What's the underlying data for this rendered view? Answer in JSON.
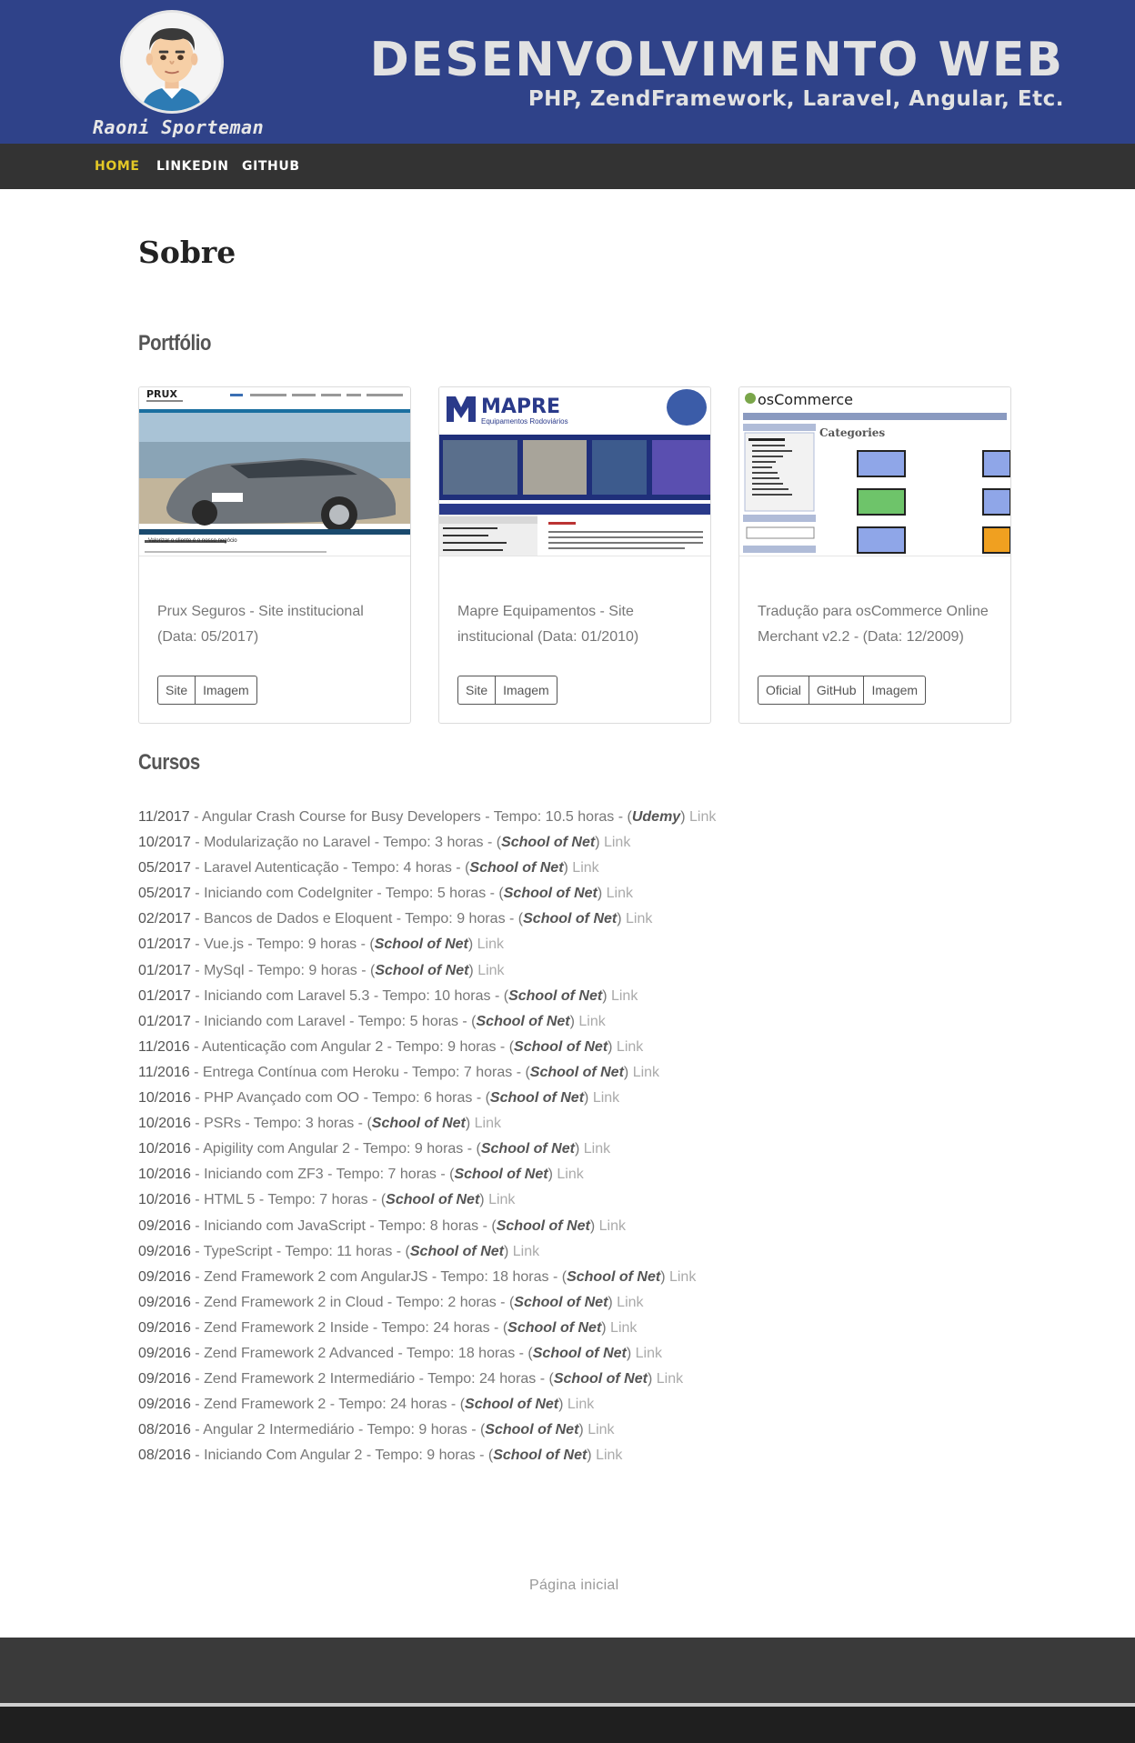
{
  "header": {
    "author": "Raoni Sporteman",
    "title": "DESENVOLVIMENTO WEB",
    "subtitle": "PHP, ZendFramework, Laravel, Angular, Etc."
  },
  "nav": {
    "items": [
      {
        "label": "HOME",
        "active": true
      },
      {
        "label": "LINKEDIN",
        "active": false
      },
      {
        "label": "GITHUB",
        "active": false
      }
    ]
  },
  "page": {
    "title": "Sobre",
    "portfolio_heading": "Portfólio",
    "courses_heading": "Cursos",
    "home_link": "Página inicial"
  },
  "portfolio": [
    {
      "thumb_brand": "PRUX",
      "thumb_tagline": "Valorizar o cliente é o nosso negócio",
      "description": "Prux Seguros - Site institucional (Data: 05/2017)",
      "buttons": [
        "Site",
        "Imagem"
      ]
    },
    {
      "thumb_brand": "MAPRE",
      "thumb_tagline": "Equipamentos Rodoviários",
      "description": "Mapre Equipamentos - Site institucional (Data: 01/2010)",
      "buttons": [
        "Site",
        "Imagem"
      ]
    },
    {
      "thumb_brand": "osCommerce",
      "thumb_tagline": "Categories",
      "description": "Tradução para osCommerce Online Merchant v2.2 - (Data: 12/2009)",
      "buttons": [
        "Oficial",
        "GitHub",
        "Imagem"
      ]
    }
  ],
  "courses": [
    {
      "date": "11/2017",
      "title": "Angular Crash Course for Busy Developers",
      "hours": "10.5",
      "school": "Udemy"
    },
    {
      "date": "10/2017",
      "title": "Modularização no Laravel",
      "hours": "3",
      "school": "School of Net"
    },
    {
      "date": "05/2017",
      "title": "Laravel Autenticação",
      "hours": "4",
      "school": "School of Net"
    },
    {
      "date": "05/2017",
      "title": "Iniciando com CodeIgniter",
      "hours": "5",
      "school": "School of Net"
    },
    {
      "date": "02/2017",
      "title": "Bancos de Dados e Eloquent",
      "hours": "9",
      "school": "School of Net"
    },
    {
      "date": "01/2017",
      "title": "Vue.js",
      "hours": "9",
      "school": "School of Net"
    },
    {
      "date": "01/2017",
      "title": "MySql",
      "hours": "9",
      "school": "School of Net"
    },
    {
      "date": "01/2017",
      "title": "Iniciando com Laravel 5.3",
      "hours": "10",
      "school": "School of Net"
    },
    {
      "date": "01/2017",
      "title": "Iniciando com Laravel",
      "hours": "5",
      "school": "School of Net"
    },
    {
      "date": "11/2016",
      "title": "Autenticação com Angular 2",
      "hours": "9",
      "school": "School of Net"
    },
    {
      "date": "11/2016",
      "title": "Entrega Contínua com Heroku",
      "hours": "7",
      "school": "School of Net"
    },
    {
      "date": "10/2016",
      "title": "PHP Avançado com OO",
      "hours": "6",
      "school": "School of Net"
    },
    {
      "date": "10/2016",
      "title": "PSRs",
      "hours": "3",
      "school": "School of Net"
    },
    {
      "date": "10/2016",
      "title": "Apigility com Angular 2",
      "hours": "9",
      "school": "School of Net"
    },
    {
      "date": "10/2016",
      "title": "Iniciando com ZF3",
      "hours": "7",
      "school": "School of Net"
    },
    {
      "date": "10/2016",
      "title": "HTML 5",
      "hours": "7",
      "school": "School of Net"
    },
    {
      "date": "09/2016",
      "title": "Iniciando com JavaScript",
      "hours": "8",
      "school": "School of Net"
    },
    {
      "date": "09/2016",
      "title": "TypeScript",
      "hours": "11",
      "school": "School of Net"
    },
    {
      "date": "09/2016",
      "title": "Zend Framework 2 com AngularJS",
      "hours": "18",
      "school": "School of Net"
    },
    {
      "date": "09/2016",
      "title": "Zend Framework 2 in Cloud",
      "hours": "2",
      "school": "School of Net"
    },
    {
      "date": "09/2016",
      "title": "Zend Framework 2 Inside",
      "hours": "24",
      "school": "School of Net"
    },
    {
      "date": "09/2016",
      "title": "Zend Framework 2 Advanced",
      "hours": "18",
      "school": "School of Net"
    },
    {
      "date": "09/2016",
      "title": "Zend Framework 2 Intermediário",
      "hours": "24",
      "school": "School of Net"
    },
    {
      "date": "09/2016",
      "title": "Zend Framework 2",
      "hours": "24",
      "school": "School of Net"
    },
    {
      "date": "08/2016",
      "title": "Angular 2 Intermediário",
      "hours": "9",
      "school": "School of Net"
    },
    {
      "date": "08/2016",
      "title": "Iniciando Com Angular 2",
      "hours": "9",
      "school": "School of Net"
    }
  ],
  "course_labels": {
    "time_prefix": "Tempo:",
    "hours_suffix": "horas",
    "link": "Link"
  },
  "colors": {
    "header_bg": "#2f4289",
    "nav_bg": "#333333",
    "nav_active": "#e3c826",
    "footer_bg": "#3a3a3a"
  }
}
